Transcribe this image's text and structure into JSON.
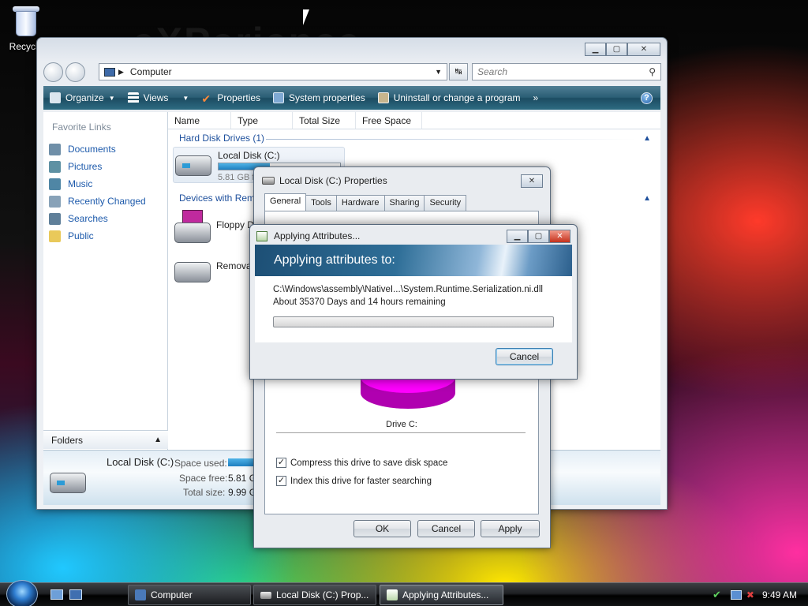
{
  "desktop": {
    "recycle_label": "Recycle",
    "watermark": "eXPerience"
  },
  "explorer": {
    "address": "Computer",
    "search_placeholder": "Search",
    "toolbar": {
      "organize": "Organize",
      "views": "Views",
      "properties": "Properties",
      "system_properties": "System properties",
      "uninstall": "Uninstall or change a program",
      "more": "»"
    },
    "favorite_links_header": "Favorite Links",
    "favorite_links": [
      "Documents",
      "Pictures",
      "Music",
      "Recently Changed",
      "Searches",
      "Public"
    ],
    "folders_label": "Folders",
    "columns": [
      "Name",
      "Type",
      "Total Size",
      "Free Space"
    ],
    "group_hard_disk": "Hard Disk Drives (1)",
    "group_removable": "Devices with Remo",
    "local_disk": {
      "name": "Local Disk (C:)",
      "free": "5.81 GB f",
      "fill_fraction": 0.42
    },
    "floppy": "Floppy D",
    "removable": "Remova",
    "details": {
      "name": "Local Disk (C:)",
      "space_used_label": "Space used:",
      "space_free_label": "Space free:",
      "space_free_value": "5.81 G",
      "total_size_label": "Total size:",
      "total_size_value": "9.99 G"
    }
  },
  "properties_dialog": {
    "title": "Local Disk (C:) Properties",
    "tabs": [
      "General",
      "Tools",
      "Hardware",
      "Sharing",
      "Security"
    ],
    "drive_label": "Drive C:",
    "compress_label": "Compress this drive to save disk space",
    "index_label": "Index this drive for faster searching",
    "compress_checked": true,
    "index_checked": true,
    "ok": "OK",
    "cancel": "Cancel",
    "apply": "Apply",
    "check_mark": "✓"
  },
  "applying_dialog": {
    "title": "Applying Attributes...",
    "heading": "Applying attributes to:",
    "path": "C:\\Windows\\assembly\\NativeI...\\System.Runtime.Serialization.ni.dll",
    "remaining": "About 35370 Days and 14 hours remaining",
    "progress_fraction": 0,
    "cancel": "Cancel"
  },
  "taskbar": {
    "items": [
      "Computer",
      "Local Disk (C:) Prop...",
      "Applying Attributes..."
    ],
    "clock": "9:49 AM"
  },
  "colors": {
    "toolbar": "#2a5e75",
    "link": "#1d5aab",
    "pie_used": "#ff00ff",
    "banner": "#1d4f75"
  }
}
